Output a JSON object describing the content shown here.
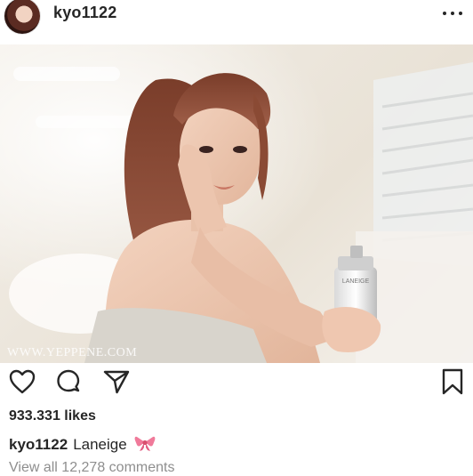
{
  "post": {
    "username": "kyo1122",
    "likes_text": "933.331 likes",
    "caption_user": "kyo1122",
    "caption_text": "Laneige",
    "caption_emoji": "ribbon-bow-emoji",
    "view_comments": "View all 12,278 comments",
    "watermark": "WWW.YEPPENE.COM",
    "product_brand": "LANEIGE"
  },
  "icons": {
    "more": "more-horizontal-icon",
    "like": "heart-icon",
    "comment": "comment-bubble-icon",
    "share": "paper-plane-icon",
    "save": "bookmark-icon"
  },
  "colors": {
    "text": "#262626",
    "muted": "#8e8e8e",
    "bow": "#f07a9a"
  }
}
